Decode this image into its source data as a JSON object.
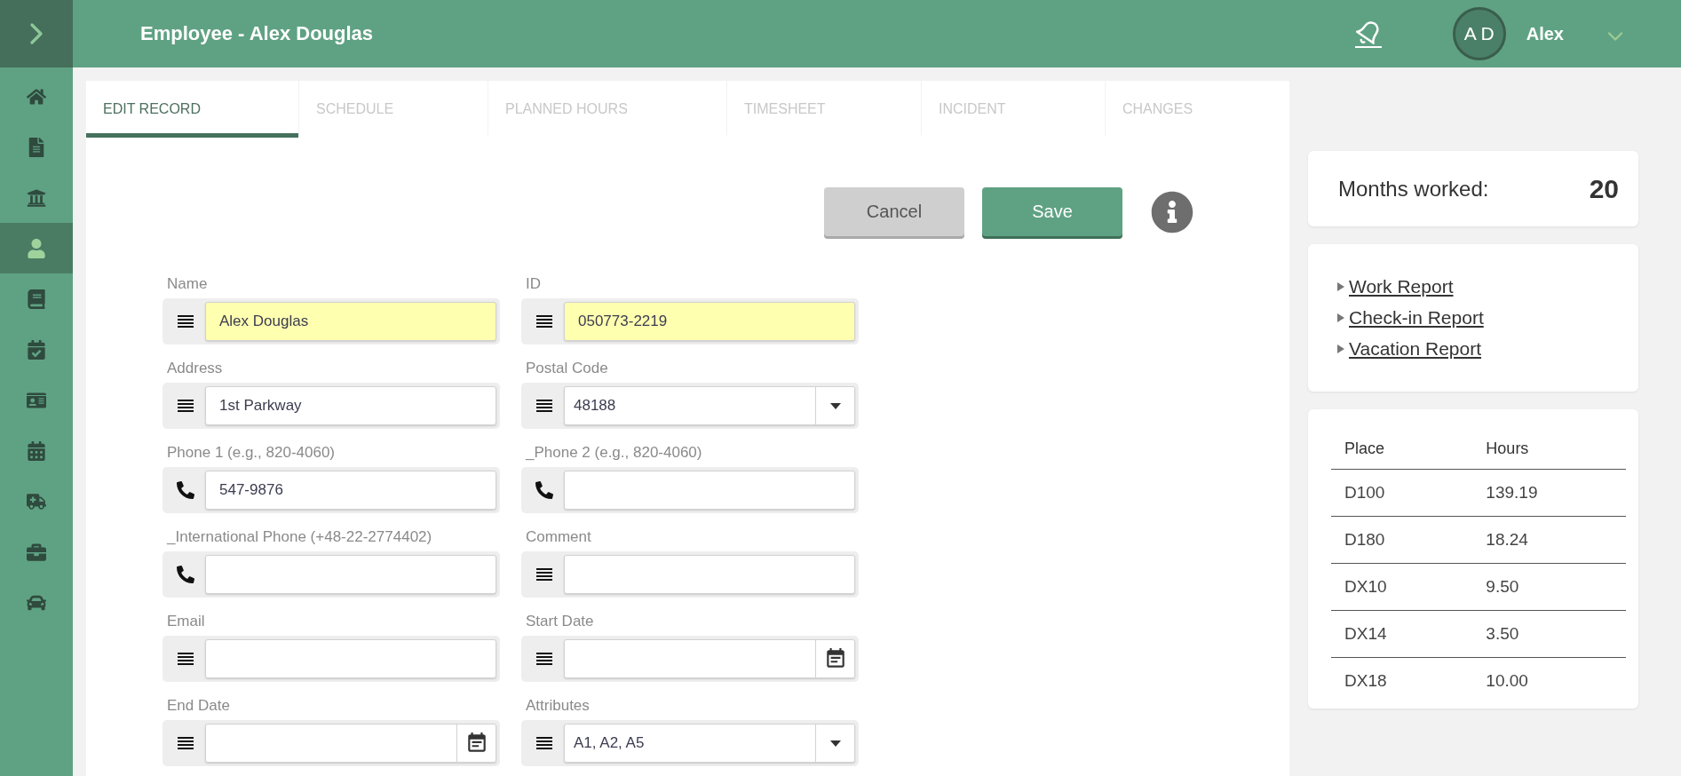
{
  "header": {
    "title": "Employee - Alex Douglas",
    "avatar_initials": "A D",
    "user_name": "Alex"
  },
  "sidebar": {
    "items": [
      {
        "selected": false
      },
      {
        "selected": false
      },
      {
        "selected": false
      },
      {
        "selected": true
      },
      {
        "selected": false
      },
      {
        "selected": false
      },
      {
        "selected": false
      },
      {
        "selected": false
      },
      {
        "selected": false
      },
      {
        "selected": false
      },
      {
        "selected": false
      }
    ]
  },
  "tabs": [
    {
      "label": "EDIT RECORD",
      "selected": true
    },
    {
      "label": "SCHEDULE",
      "selected": false
    },
    {
      "label": "PLANNED HOURS",
      "selected": false
    },
    {
      "label": "TIMESHEET",
      "selected": false
    },
    {
      "label": "INCIDENT",
      "selected": false
    },
    {
      "label": "CHANGES",
      "selected": false
    }
  ],
  "buttons": [
    {
      "label": "Cancel",
      "kind": "secondary"
    },
    {
      "label": "Save",
      "kind": "primary"
    }
  ],
  "form": {
    "fields": [
      {
        "label": "Name",
        "kind": "text",
        "value": "Alex Douglas",
        "highlighted": true
      },
      {
        "label": "ID",
        "kind": "text",
        "value": "050773-2219",
        "highlighted": true
      },
      {
        "label": "Address",
        "kind": "text",
        "value": "1st Parkway",
        "highlighted": false
      },
      {
        "label": "Postal Code",
        "kind": "select",
        "value": "48188",
        "highlighted": false
      },
      {
        "label": "Phone 1 (e.g., 820-4060)",
        "kind": "phone",
        "value": "547-9876",
        "highlighted": false
      },
      {
        "label": "_Phone 2 (e.g., 820-4060)",
        "kind": "phone",
        "highlighted": false
      },
      {
        "label": "_International Phone (+48-22-2774402)",
        "kind": "phone",
        "highlighted": false
      },
      {
        "label": "Comment",
        "kind": "text",
        "highlighted": false
      },
      {
        "label": "Email",
        "kind": "text",
        "highlighted": false
      },
      {
        "label": "Start Date",
        "kind": "date",
        "highlighted": false
      },
      {
        "label": "End Date",
        "kind": "date",
        "highlighted": false
      },
      {
        "label": "Attributes",
        "kind": "select",
        "value": "A1, A2, A5",
        "highlighted": false
      }
    ]
  },
  "summary": {
    "label": "Months worked:",
    "value": "20"
  },
  "reports": [
    "Work Report",
    "Check-in Report",
    "Vacation Report"
  ],
  "hours_table": {
    "columns": [
      "Place",
      "Hours"
    ],
    "rows": [
      [
        "D100",
        "139.19"
      ],
      [
        "D180",
        "18.24"
      ],
      [
        "DX10",
        "9.50"
      ],
      [
        "DX14",
        "3.50"
      ],
      [
        "DX18",
        "10.00"
      ]
    ]
  }
}
